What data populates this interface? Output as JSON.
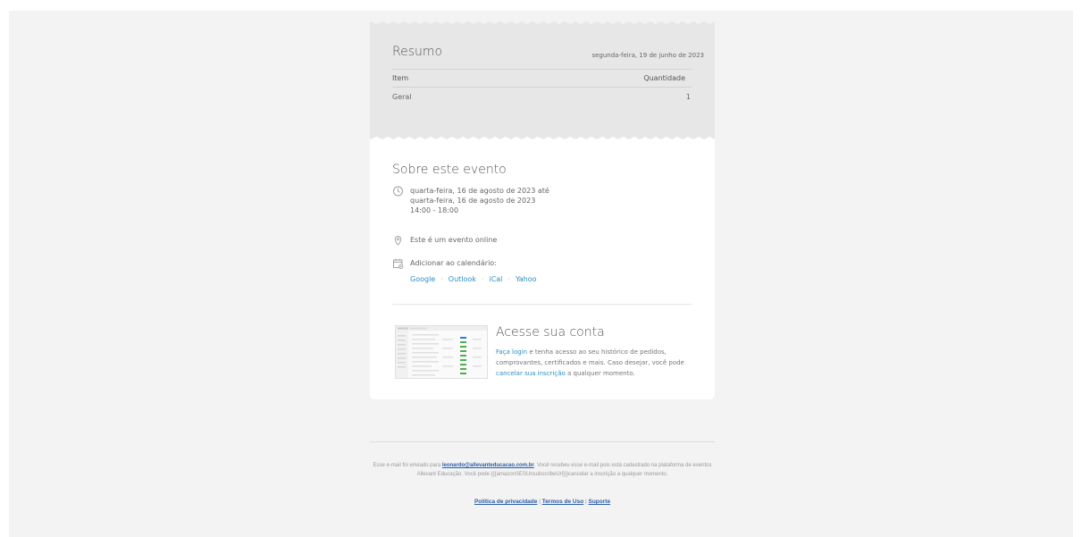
{
  "summary": {
    "title": "Resumo",
    "date": "segunda-feira, 19 de junho de 2023",
    "columns": {
      "item": "Item",
      "quantity": "Quantidade"
    },
    "rows": [
      {
        "item": "Geral",
        "quantity": "1"
      }
    ]
  },
  "event": {
    "title": "Sobre este evento",
    "date_line1": "quarta-feira, 16 de agosto de 2023 até",
    "date_line2": "quarta-feira, 16 de agosto de 2023",
    "time": "14:00 - 18:00",
    "location": "Este é um evento online",
    "calendar_label": "Adicionar ao calendário:",
    "calendar_links": [
      "Google",
      "Outlook",
      "iCal",
      "Yahoo"
    ],
    "link_separator": "·"
  },
  "account": {
    "title": "Acesse sua conta",
    "login_link": "Faça login",
    "text1": " e tenha acesso ao seu histórico de pedidos, comprovantes, certificados e mais. Caso desejar, você pode ",
    "unsubscribe_link": "cancelar sua inscrição",
    "text2": " a qualquer momento."
  },
  "footer": {
    "text1": "Esse e-mail foi enviado para ",
    "email": "leonardo@allevanteducacao.com.br",
    "text2": ". Você recebeu esse e-mail pois está cadastrado na plataforma de eventos Allevant Educação. Você pode {{{amazonSESUnsubscribeUrl}}}cancelar a inscrição a qualquer momento.",
    "privacy": "Política de privacidade",
    "terms": "Termos de Uso",
    "support": "Suporte",
    "separator": " | "
  },
  "colors": {
    "link": "#2a8fc5",
    "footer_link": "#2a5da8",
    "summary_bg": "#e7e7e7",
    "page_bg": "#f3f3f3"
  },
  "icons": {
    "date": "clock-icon",
    "location": "location-pin-icon",
    "calendar": "calendar-add-icon"
  }
}
